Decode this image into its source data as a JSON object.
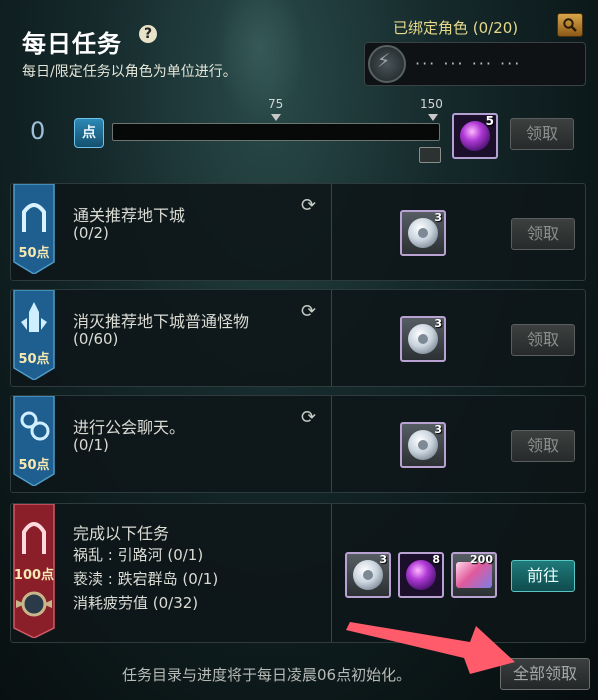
{
  "header": {
    "title": "每日任务",
    "help_glyph": "?",
    "subtitle": "每日/限定任务以角色为单位进行。",
    "bound_label": "已绑定角色 (0/20)",
    "char_mask": "··· ··· ··· ···",
    "lightning_glyph": "⚡"
  },
  "progress": {
    "current": "0",
    "point_badge": "点",
    "marker_mid": "75",
    "marker_max": "150",
    "fill_fraction": 0,
    "reward_count": "5",
    "claim_label": "领取"
  },
  "quests": [
    {
      "title": "通关推荐地下城",
      "progress": "(0/2)",
      "points": "50点",
      "reward_count": "3",
      "claim_label": "领取",
      "refresh": "⟳"
    },
    {
      "title": "消灭推荐地下城普通怪物",
      "progress": "(0/60)",
      "points": "50点",
      "reward_count": "3",
      "claim_label": "领取",
      "refresh": "⟳"
    },
    {
      "title": "进行公会聊天。",
      "progress": "(0/1)",
      "points": "50点",
      "reward_count": "3",
      "claim_label": "领取",
      "refresh": "⟳"
    }
  ],
  "special_quest": {
    "title": "完成以下任务",
    "lines": [
      "祸乱 : 引路河 (0/1)",
      "亵渎 : 跌宕群岛 (0/1)",
      "消耗疲劳值 (0/32)"
    ],
    "points": "100点",
    "rewards": [
      "3",
      "8",
      "200"
    ],
    "go_label": "前往"
  },
  "footer": {
    "note": "任务目录与进度将于每日凌晨06点初始化。",
    "claim_all_label": "全部领取"
  },
  "colors": {
    "blue_badge": "#1f5f8f",
    "red_badge": "#8a1f2a",
    "accent_teal": "#1f7a7a",
    "annotation_arrow": "#ff5b6b"
  }
}
